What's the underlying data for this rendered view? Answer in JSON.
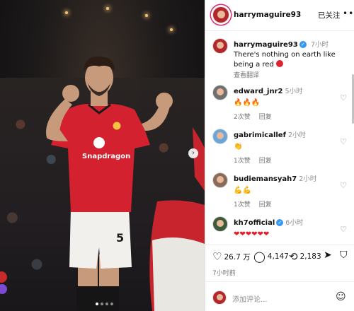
{
  "post": {
    "username": "harrymaguire93",
    "follow_label": "已关注",
    "more_label": "•••"
  },
  "caption": {
    "username": "harrymaguire93",
    "time": "7小时",
    "text": "There's nothing on earth like being a red",
    "translate_label": "查看翻译"
  },
  "comments": [
    {
      "username": "edward_jnr2",
      "time": "5小时",
      "text": "🔥🔥🔥",
      "likes": "2次赞",
      "reply": "回复"
    },
    {
      "username": "gabrimicallef",
      "time": "2小时",
      "text": "👏",
      "likes": "1次赞",
      "reply": "回复"
    },
    {
      "username": "budiemansyah7",
      "time": "2小时",
      "text": "💪💪",
      "likes": "1次赞",
      "reply": "回复"
    },
    {
      "username": "kh7official",
      "time": "6小时",
      "text": "❤❤❤❤❤❤",
      "likes": "",
      "reply": ""
    }
  ],
  "actions": {
    "likes": "26.7 万",
    "comments": "4,147",
    "reposts": "2,183",
    "time": "7小时前"
  },
  "composer": {
    "placeholder": "添加评论..."
  },
  "colors": {
    "jersey_red": "#d3212f",
    "verified_blue": "#3897f0"
  },
  "photo": {
    "sponsor": "Snapdragon",
    "shirt_number": "5"
  }
}
